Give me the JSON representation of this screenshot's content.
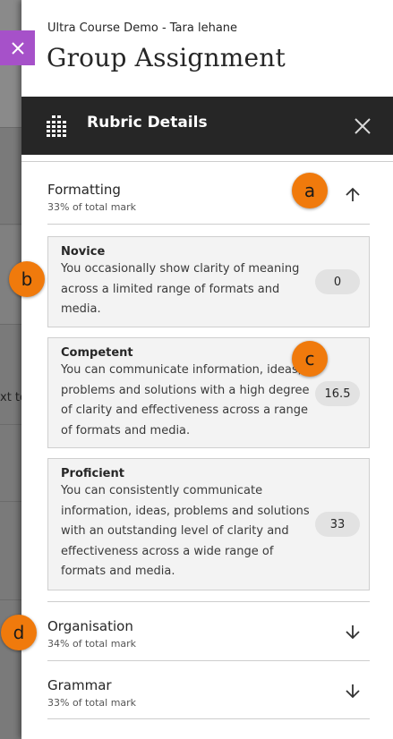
{
  "background": {
    "text_fragment": "xt to"
  },
  "header": {
    "course_name": "Ultra Course Demo - Tara lehane",
    "page_title": "Group Assignment"
  },
  "rubric_bar": {
    "title": "Rubric Details",
    "icon": "rubric-grid-icon",
    "close_icon": "close-icon"
  },
  "criteria": [
    {
      "name": "Formatting",
      "weight": "33% of total mark",
      "expanded": true,
      "levels": [
        {
          "name": "Novice",
          "description": "You occasionally show clarity of meaning across a limited range of formats and media.",
          "points": "0"
        },
        {
          "name": "Competent",
          "description": "You can communicate information, ideas, problems and solutions with a high degree of clarity and effectiveness across a range of formats and media.",
          "points": "16.5"
        },
        {
          "name": "Proficient",
          "description": "You can consistently communicate information, ideas, problems and solutions with an outstanding level of clarity and effectiveness across a wide range of formats and media.",
          "points": "33"
        }
      ]
    },
    {
      "name": "Organisation",
      "weight": "34% of total mark",
      "expanded": false
    },
    {
      "name": "Grammar",
      "weight": "33% of total mark",
      "expanded": false
    }
  ],
  "callouts": [
    "a",
    "b",
    "c",
    "d"
  ],
  "colors": {
    "bar": "#262626",
    "callout": "#f07a0c",
    "close_back": "#a651c9"
  }
}
